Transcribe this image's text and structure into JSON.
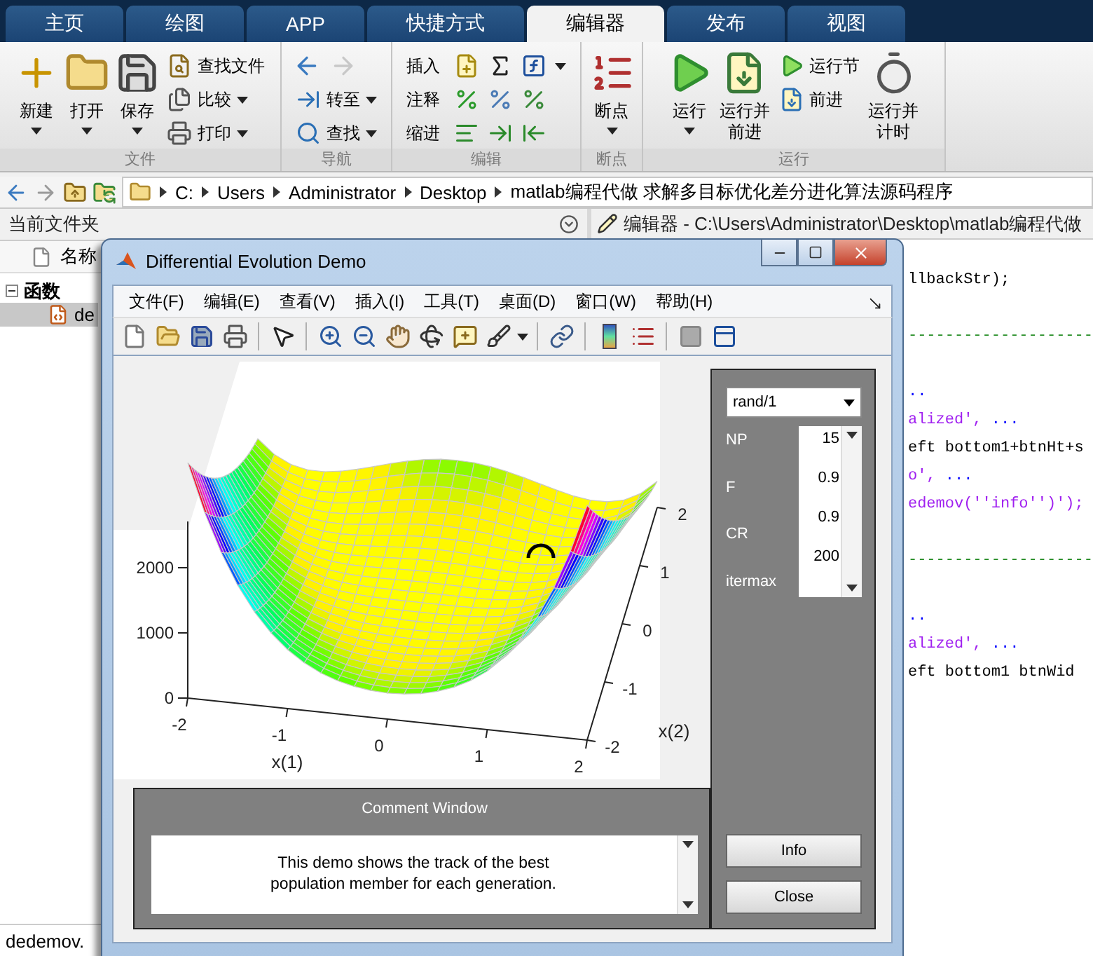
{
  "ribbon_tabs": [
    {
      "label": "主页",
      "selected": false
    },
    {
      "label": "绘图",
      "selected": false
    },
    {
      "label": "APP",
      "selected": false
    },
    {
      "label": "快捷方式",
      "selected": false
    },
    {
      "label": "编辑器",
      "selected": true
    },
    {
      "label": "发布",
      "selected": false
    },
    {
      "label": "视图",
      "selected": false
    }
  ],
  "ribbon_groups": [
    {
      "title": "文件",
      "items": [
        {
          "kind": "large",
          "label": "新建",
          "dropdown": true
        },
        {
          "kind": "large",
          "label": "打开",
          "dropdown": true
        },
        {
          "kind": "large",
          "label": "保存",
          "dropdown": true
        },
        {
          "kind": "stack",
          "entries": [
            {
              "kind": "button",
              "label": "查找文件",
              "dropdown": false
            },
            {
              "kind": "button",
              "label": "比较",
              "dropdown": true
            },
            {
              "kind": "button",
              "label": "打印",
              "dropdown": true
            }
          ]
        }
      ]
    },
    {
      "title": "导航",
      "items": [
        {
          "kind": "stack",
          "entries": [
            {
              "kind": "arrows",
              "arrows": [
                {
                  "disabled": false
                },
                {
                  "disabled": true
                }
              ]
            },
            {
              "kind": "button",
              "label": "转至",
              "dropdown": true
            },
            {
              "kind": "button",
              "label": "查找",
              "dropdown": true
            }
          ]
        }
      ]
    },
    {
      "title": "编辑",
      "items": [
        {
          "kind": "stack",
          "entries": [
            {
              "kind": "icon-row",
              "label": "插入"
            },
            {
              "kind": "icon-row",
              "label": "注释"
            },
            {
              "kind": "icon-row",
              "label": "缩进"
            }
          ]
        }
      ]
    },
    {
      "title": "断点",
      "items": [
        {
          "kind": "large",
          "label": "断点",
          "dropdown": true
        }
      ]
    },
    {
      "title": "运行",
      "items": [
        {
          "kind": "large",
          "label": "运行",
          "dropdown": true
        },
        {
          "kind": "large",
          "label": "运行并前进",
          "dropdown": false
        },
        {
          "kind": "stack",
          "entries": [
            {
              "kind": "button",
              "label": "运行节",
              "dropdown": false
            },
            {
              "kind": "button",
              "label": "前进",
              "dropdown": false
            }
          ]
        },
        {
          "kind": "large",
          "label": "运行并计时",
          "dropdown": false
        }
      ]
    }
  ],
  "address_bar": {
    "arrows": [
      {
        "disabled": false
      },
      {
        "disabled": true
      }
    ],
    "path": [
      "C:",
      "Users",
      "Administrator",
      "Desktop",
      "matlab编程代做 求解多目标优化差分进化算法源码程序"
    ]
  },
  "file_browser": {
    "title": "当前文件夹",
    "column": "名称",
    "tree": [
      {
        "label": "函数",
        "expanded": true,
        "children": [
          {
            "label": "de",
            "selected": true
          }
        ]
      }
    ],
    "status": "dedemov."
  },
  "editor": {
    "title": "编辑器 - C:\\Users\\Administrator\\Desktop\\matlab编程代做",
    "lines": [
      {
        "kind": "text",
        "tokens": [
          {
            "kind": "code",
            "text": "llbackStr);"
          }
        ]
      },
      {
        "kind": "blank"
      },
      {
        "kind": "text",
        "tokens": [
          {
            "kind": "comment",
            "text": "--------------------"
          }
        ]
      },
      {
        "kind": "blank"
      },
      {
        "kind": "text",
        "tokens": [
          {
            "kind": "keyword",
            "text": ".."
          }
        ]
      },
      {
        "kind": "text",
        "tokens": [
          {
            "kind": "string",
            "text": "alized',"
          },
          {
            "kind": "keyword",
            "text": " ..."
          }
        ]
      },
      {
        "kind": "text",
        "tokens": [
          {
            "kind": "code",
            "text": "eft bottom1+btnHt+s"
          }
        ]
      },
      {
        "kind": "text",
        "tokens": [
          {
            "kind": "string",
            "text": "o',"
          },
          {
            "kind": "keyword",
            "text": " ..."
          }
        ]
      },
      {
        "kind": "text",
        "tokens": [
          {
            "kind": "string",
            "text": "edemov(''info'')');"
          }
        ]
      },
      {
        "kind": "blank"
      },
      {
        "kind": "text",
        "tokens": [
          {
            "kind": "comment",
            "text": "--------------------"
          }
        ]
      },
      {
        "kind": "blank"
      },
      {
        "kind": "text",
        "tokens": [
          {
            "kind": "keyword",
            "text": ".."
          }
        ]
      },
      {
        "kind": "text",
        "tokens": [
          {
            "kind": "string",
            "text": "alized',"
          },
          {
            "kind": "keyword",
            "text": " ..."
          }
        ]
      },
      {
        "kind": "text",
        "tokens": [
          {
            "kind": "code",
            "text": "eft bottom1 btnWid"
          }
        ]
      }
    ]
  },
  "figure_window": {
    "title": "Differential Evolution Demo",
    "menu": [
      "文件(F)",
      "编辑(E)",
      "查看(V)",
      "插入(I)",
      "工具(T)",
      "桌面(D)",
      "窗口(W)",
      "帮助(H)"
    ],
    "plot": {
      "z_ticks": [
        "2000",
        "1000",
        "0"
      ],
      "x1_ticks": [
        "-2",
        "-1",
        "0",
        "1",
        "2"
      ],
      "x1_label": "x(1)",
      "x2_ticks": [
        "-2",
        "-1",
        "0",
        "1",
        "2"
      ],
      "x2_label": "x(2)"
    },
    "controls": {
      "strategy": "rand/1",
      "params": [
        {
          "name": "NP",
          "value": "15"
        },
        {
          "name": "F",
          "value": "0.9"
        },
        {
          "name": "CR",
          "value": "0.9"
        },
        {
          "name": "itermax",
          "value": "200"
        }
      ],
      "buttons": [
        "Info",
        "Close"
      ]
    },
    "comment": {
      "title": "Comment Window",
      "text": "This demo shows the track of the best population member for each generation."
    }
  }
}
